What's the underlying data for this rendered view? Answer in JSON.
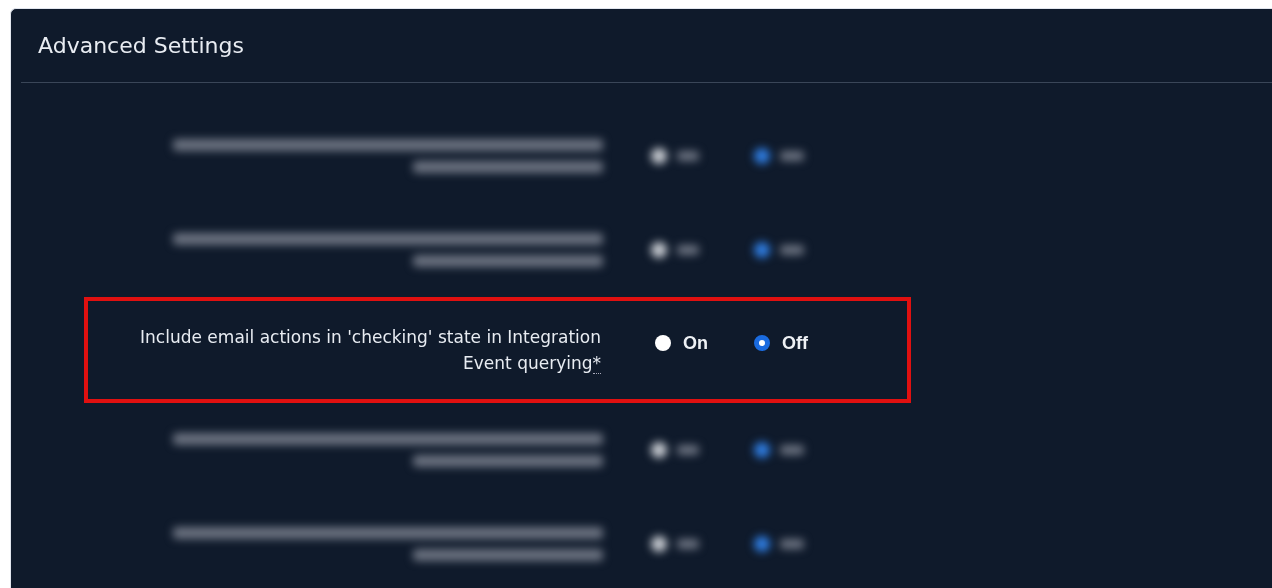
{
  "panel": {
    "title": "Advanced Settings"
  },
  "rows": [
    {
      "kind": "blurred"
    },
    {
      "kind": "blurred"
    },
    {
      "kind": "setting",
      "highlighted": true,
      "label": "Include email actions in 'checking' state in Integration Event querying",
      "required_mark": "*",
      "options": [
        {
          "label": "On",
          "selected": false
        },
        {
          "label": "Off",
          "selected": true
        }
      ]
    },
    {
      "kind": "blurred"
    },
    {
      "kind": "blurred"
    }
  ]
}
